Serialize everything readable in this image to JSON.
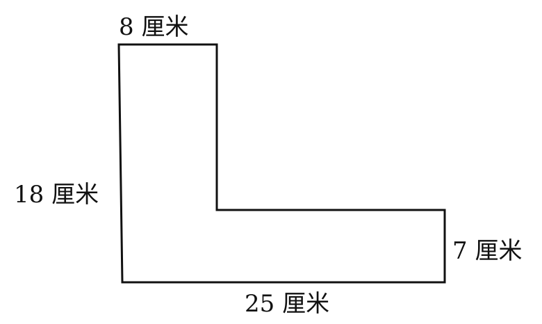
{
  "figure": {
    "shape": "L-shape",
    "stroke_color": "#111111",
    "background_color": "#ffffff",
    "labels": {
      "top": "8 厘米",
      "left": "18 厘米",
      "right": "7 厘米",
      "bottom": "25 厘米"
    }
  }
}
